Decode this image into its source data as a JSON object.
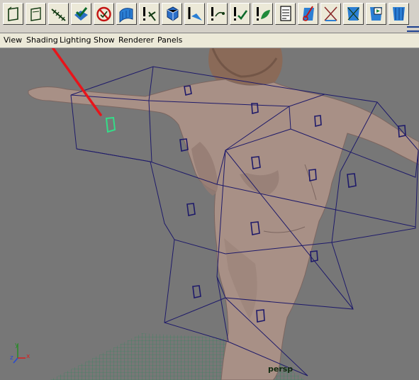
{
  "menubar": {
    "view": "View",
    "shading": "Shading",
    "lighting": "Lighting",
    "show": "Show",
    "renderer": "Renderer",
    "panels": "Panels"
  },
  "shelf": {
    "icons": [
      "frame-icon",
      "frame-outline-icon",
      "stitch-icon",
      "checkmark-shield-icon",
      "no-entry-icon",
      "cloth-sheet-icon",
      "exclamation-tool-icon",
      "constraint-box-icon",
      "field-icon",
      "exclamation-arrow-icon",
      "exclamation-check-icon",
      "exclamation-leaf-icon",
      "document-list-icon",
      "paint-brush-icon",
      "cross-icon",
      "curtain-icon",
      "play-curtain-icon"
    ]
  },
  "viewport": {
    "camera_label": "persp",
    "background_color": "#777777",
    "wire_color": "#1e1a6a",
    "selected_color": "#33dd88",
    "annotation_color": "#e8141a",
    "axes": {
      "y": "y",
      "z": "z",
      "x": "x"
    }
  }
}
